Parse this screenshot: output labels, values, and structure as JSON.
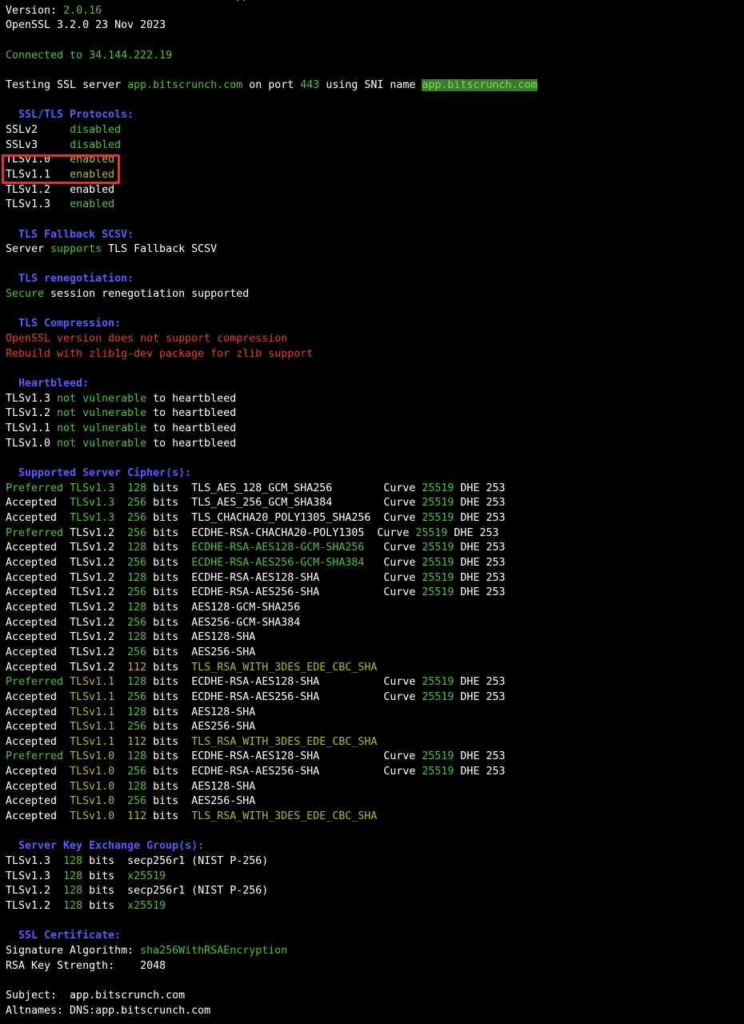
{
  "terminal": {
    "lines": [
      [
        {
          "t": "/Users/thatsshahid@... ~ % sslscan app.bitscrunch.com",
          "c": "white"
        }
      ],
      [
        {
          "t": "Version: ",
          "c": "white"
        },
        {
          "t": "2.0.16",
          "c": "green"
        }
      ],
      [
        {
          "t": "OpenSSL 3.2.0 23 Nov 2023",
          "c": "white"
        }
      ],
      [],
      [
        {
          "t": "Connected to 34.144.222.19",
          "c": "green"
        }
      ],
      [],
      [
        {
          "t": "Testing SSL server ",
          "c": "white"
        },
        {
          "t": "app.bitscrunch.com",
          "c": "green"
        },
        {
          "t": " on port ",
          "c": "white"
        },
        {
          "t": "443",
          "c": "green"
        },
        {
          "t": " using SNI name ",
          "c": "white"
        },
        {
          "t": "app.bitscrunch.com",
          "c": "hl"
        }
      ],
      [],
      [
        {
          "t": "  SSL/TLS Protocols:",
          "c": "blue"
        }
      ],
      [
        {
          "t": "SSLv2     ",
          "c": "white"
        },
        {
          "t": "disabled",
          "c": "green"
        }
      ],
      [
        {
          "t": "SSLv3     ",
          "c": "white"
        },
        {
          "t": "disabled",
          "c": "green"
        }
      ],
      [
        {
          "t": "TLSv1.0   ",
          "c": "white"
        },
        {
          "t": "enabled",
          "c": "yellow"
        }
      ],
      [
        {
          "t": "TLSv1.1   ",
          "c": "white"
        },
        {
          "t": "enabled",
          "c": "yellow"
        }
      ],
      [
        {
          "t": "TLSv1.2   ",
          "c": "white"
        },
        {
          "t": "enabled",
          "c": "white"
        }
      ],
      [
        {
          "t": "TLSv1.3   ",
          "c": "white"
        },
        {
          "t": "enabled",
          "c": "green"
        }
      ],
      [],
      [
        {
          "t": "  TLS Fallback SCSV:",
          "c": "blue"
        }
      ],
      [
        {
          "t": "Server ",
          "c": "white"
        },
        {
          "t": "supports",
          "c": "green"
        },
        {
          "t": " TLS Fallback SCSV",
          "c": "white"
        }
      ],
      [],
      [
        {
          "t": "  TLS renegotiation:",
          "c": "blue"
        }
      ],
      [
        {
          "t": "Secure",
          "c": "green"
        },
        {
          "t": " session renegotiation supported",
          "c": "white"
        }
      ],
      [],
      [
        {
          "t": "  TLS Compression:",
          "c": "blue"
        }
      ],
      [
        {
          "t": "OpenSSL version does not support compression",
          "c": "red"
        }
      ],
      [
        {
          "t": "Rebuild with zlib1g-dev package for zlib support",
          "c": "red"
        }
      ],
      [],
      [
        {
          "t": "  Heartbleed:",
          "c": "blue"
        }
      ],
      [
        {
          "t": "TLSv1.3 ",
          "c": "white"
        },
        {
          "t": "not vulnerable",
          "c": "green"
        },
        {
          "t": " to heartbleed",
          "c": "white"
        }
      ],
      [
        {
          "t": "TLSv1.2 ",
          "c": "white"
        },
        {
          "t": "not vulnerable",
          "c": "green"
        },
        {
          "t": " to heartbleed",
          "c": "white"
        }
      ],
      [
        {
          "t": "TLSv1.1 ",
          "c": "white"
        },
        {
          "t": "not vulnerable",
          "c": "green"
        },
        {
          "t": " to heartbleed",
          "c": "white"
        }
      ],
      [
        {
          "t": "TLSv1.0 ",
          "c": "white"
        },
        {
          "t": "not vulnerable",
          "c": "green"
        },
        {
          "t": " to heartbleed",
          "c": "white"
        }
      ],
      [],
      [
        {
          "t": "  Supported Server Cipher(s):",
          "c": "blue"
        }
      ],
      [
        {
          "t": "Preferred ",
          "c": "green"
        },
        {
          "t": "TLSv1.3",
          "c": "green"
        },
        {
          "t": "  ",
          "c": "white"
        },
        {
          "t": "128",
          "c": "green"
        },
        {
          "t": " bits  TLS_AES_128_GCM_SHA256        Curve ",
          "c": "white"
        },
        {
          "t": "25519",
          "c": "green"
        },
        {
          "t": " DHE 253",
          "c": "white"
        }
      ],
      [
        {
          "t": "Accepted  ",
          "c": "white"
        },
        {
          "t": "TLSv1.3",
          "c": "green"
        },
        {
          "t": "  ",
          "c": "white"
        },
        {
          "t": "256",
          "c": "green"
        },
        {
          "t": " bits  TLS_AES_256_GCM_SHA384        Curve ",
          "c": "white"
        },
        {
          "t": "25519",
          "c": "green"
        },
        {
          "t": " DHE 253",
          "c": "white"
        }
      ],
      [
        {
          "t": "Accepted  ",
          "c": "white"
        },
        {
          "t": "TLSv1.3",
          "c": "green"
        },
        {
          "t": "  ",
          "c": "white"
        },
        {
          "t": "256",
          "c": "green"
        },
        {
          "t": " bits  TLS_CHACHA20_POLY1305_SHA256  Curve ",
          "c": "white"
        },
        {
          "t": "25519",
          "c": "green"
        },
        {
          "t": " DHE 253",
          "c": "white"
        }
      ],
      [
        {
          "t": "Preferred ",
          "c": "green"
        },
        {
          "t": "TLSv1.2",
          "c": "white"
        },
        {
          "t": "  ",
          "c": "white"
        },
        {
          "t": "256",
          "c": "green"
        },
        {
          "t": " bits  ECDHE-RSA-CHACHA20-POLY1305  Curve ",
          "c": "white"
        },
        {
          "t": "25519",
          "c": "green"
        },
        {
          "t": " DHE 253",
          "c": "white"
        }
      ],
      [
        {
          "t": "Accepted  ",
          "c": "white"
        },
        {
          "t": "TLSv1.2",
          "c": "white"
        },
        {
          "t": "  ",
          "c": "white"
        },
        {
          "t": "128",
          "c": "green"
        },
        {
          "t": " bits  ",
          "c": "white"
        },
        {
          "t": "ECDHE-RSA-AES128-GCM-SHA256",
          "c": "green"
        },
        {
          "t": "   Curve ",
          "c": "white"
        },
        {
          "t": "25519",
          "c": "green"
        },
        {
          "t": " DHE 253",
          "c": "white"
        }
      ],
      [
        {
          "t": "Accepted  ",
          "c": "white"
        },
        {
          "t": "TLSv1.2",
          "c": "white"
        },
        {
          "t": "  ",
          "c": "white"
        },
        {
          "t": "256",
          "c": "green"
        },
        {
          "t": " bits  ",
          "c": "white"
        },
        {
          "t": "ECDHE-RSA-AES256-GCM-SHA384",
          "c": "green"
        },
        {
          "t": "   Curve ",
          "c": "white"
        },
        {
          "t": "25519",
          "c": "green"
        },
        {
          "t": " DHE 253",
          "c": "white"
        }
      ],
      [
        {
          "t": "Accepted  ",
          "c": "white"
        },
        {
          "t": "TLSv1.2",
          "c": "white"
        },
        {
          "t": "  ",
          "c": "white"
        },
        {
          "t": "128",
          "c": "green"
        },
        {
          "t": " bits  ECDHE-RSA-AES128-SHA          Curve ",
          "c": "white"
        },
        {
          "t": "25519",
          "c": "green"
        },
        {
          "t": " DHE 253",
          "c": "white"
        }
      ],
      [
        {
          "t": "Accepted  ",
          "c": "white"
        },
        {
          "t": "TLSv1.2",
          "c": "white"
        },
        {
          "t": "  ",
          "c": "white"
        },
        {
          "t": "256",
          "c": "green"
        },
        {
          "t": " bits  ECDHE-RSA-AES256-SHA          Curve ",
          "c": "white"
        },
        {
          "t": "25519",
          "c": "green"
        },
        {
          "t": " DHE 253",
          "c": "white"
        }
      ],
      [
        {
          "t": "Accepted  ",
          "c": "white"
        },
        {
          "t": "TLSv1.2",
          "c": "white"
        },
        {
          "t": "  ",
          "c": "white"
        },
        {
          "t": "128",
          "c": "green"
        },
        {
          "t": " bits  AES128-GCM-SHA256",
          "c": "white"
        }
      ],
      [
        {
          "t": "Accepted  ",
          "c": "white"
        },
        {
          "t": "TLSv1.2",
          "c": "white"
        },
        {
          "t": "  ",
          "c": "white"
        },
        {
          "t": "256",
          "c": "green"
        },
        {
          "t": " bits  AES256-GCM-SHA384",
          "c": "white"
        }
      ],
      [
        {
          "t": "Accepted  ",
          "c": "white"
        },
        {
          "t": "TLSv1.2",
          "c": "white"
        },
        {
          "t": "  ",
          "c": "white"
        },
        {
          "t": "128",
          "c": "green"
        },
        {
          "t": " bits  AES128-SHA",
          "c": "white"
        }
      ],
      [
        {
          "t": "Accepted  ",
          "c": "white"
        },
        {
          "t": "TLSv1.2",
          "c": "white"
        },
        {
          "t": "  ",
          "c": "white"
        },
        {
          "t": "256",
          "c": "green"
        },
        {
          "t": " bits  AES256-SHA",
          "c": "white"
        }
      ],
      [
        {
          "t": "Accepted  ",
          "c": "white"
        },
        {
          "t": "TLSv1.2",
          "c": "white"
        },
        {
          "t": "  ",
          "c": "white"
        },
        {
          "t": "112",
          "c": "yellow"
        },
        {
          "t": " bits  ",
          "c": "white"
        },
        {
          "t": "TLS_RSA_WITH_3DES_EDE_CBC_SHA",
          "c": "yellow"
        }
      ],
      [
        {
          "t": "Preferred ",
          "c": "green"
        },
        {
          "t": "TLSv1.1",
          "c": "yellow"
        },
        {
          "t": "  ",
          "c": "white"
        },
        {
          "t": "128",
          "c": "green"
        },
        {
          "t": " bits  ECDHE-RSA-AES128-SHA          Curve ",
          "c": "white"
        },
        {
          "t": "25519",
          "c": "green"
        },
        {
          "t": " DHE 253",
          "c": "white"
        }
      ],
      [
        {
          "t": "Accepted  ",
          "c": "white"
        },
        {
          "t": "TLSv1.1",
          "c": "yellow"
        },
        {
          "t": "  ",
          "c": "white"
        },
        {
          "t": "256",
          "c": "green"
        },
        {
          "t": " bits  ECDHE-RSA-AES256-SHA          Curve ",
          "c": "white"
        },
        {
          "t": "25519",
          "c": "green"
        },
        {
          "t": " DHE 253",
          "c": "white"
        }
      ],
      [
        {
          "t": "Accepted  ",
          "c": "white"
        },
        {
          "t": "TLSv1.1",
          "c": "yellow"
        },
        {
          "t": "  ",
          "c": "white"
        },
        {
          "t": "128",
          "c": "green"
        },
        {
          "t": " bits  AES128-SHA",
          "c": "white"
        }
      ],
      [
        {
          "t": "Accepted  ",
          "c": "white"
        },
        {
          "t": "TLSv1.1",
          "c": "yellow"
        },
        {
          "t": "  ",
          "c": "white"
        },
        {
          "t": "256",
          "c": "green"
        },
        {
          "t": " bits  AES256-SHA",
          "c": "white"
        }
      ],
      [
        {
          "t": "Accepted  ",
          "c": "white"
        },
        {
          "t": "TLSv1.1",
          "c": "yellow"
        },
        {
          "t": "  ",
          "c": "white"
        },
        {
          "t": "112",
          "c": "yellow"
        },
        {
          "t": " bits  ",
          "c": "white"
        },
        {
          "t": "TLS_RSA_WITH_3DES_EDE_CBC_SHA",
          "c": "yellow"
        }
      ],
      [
        {
          "t": "Preferred ",
          "c": "green"
        },
        {
          "t": "TLSv1.0",
          "c": "yellow"
        },
        {
          "t": "  ",
          "c": "white"
        },
        {
          "t": "128",
          "c": "green"
        },
        {
          "t": " bits  ECDHE-RSA-AES128-SHA          Curve ",
          "c": "white"
        },
        {
          "t": "25519",
          "c": "green"
        },
        {
          "t": " DHE 253",
          "c": "white"
        }
      ],
      [
        {
          "t": "Accepted  ",
          "c": "white"
        },
        {
          "t": "TLSv1.0",
          "c": "yellow"
        },
        {
          "t": "  ",
          "c": "white"
        },
        {
          "t": "256",
          "c": "green"
        },
        {
          "t": " bits  ECDHE-RSA-AES256-SHA          Curve ",
          "c": "white"
        },
        {
          "t": "25519",
          "c": "green"
        },
        {
          "t": " DHE 253",
          "c": "white"
        }
      ],
      [
        {
          "t": "Accepted  ",
          "c": "white"
        },
        {
          "t": "TLSv1.0",
          "c": "yellow"
        },
        {
          "t": "  ",
          "c": "white"
        },
        {
          "t": "128",
          "c": "green"
        },
        {
          "t": " bits  AES128-SHA",
          "c": "white"
        }
      ],
      [
        {
          "t": "Accepted  ",
          "c": "white"
        },
        {
          "t": "TLSv1.0",
          "c": "yellow"
        },
        {
          "t": "  ",
          "c": "white"
        },
        {
          "t": "256",
          "c": "green"
        },
        {
          "t": " bits  AES256-SHA",
          "c": "white"
        }
      ],
      [
        {
          "t": "Accepted  ",
          "c": "white"
        },
        {
          "t": "TLSv1.0",
          "c": "yellow"
        },
        {
          "t": "  ",
          "c": "white"
        },
        {
          "t": "112",
          "c": "yellow"
        },
        {
          "t": " bits  ",
          "c": "white"
        },
        {
          "t": "TLS_RSA_WITH_3DES_EDE_CBC_SHA",
          "c": "yellow"
        }
      ],
      [],
      [
        {
          "t": "  Server Key Exchange Group(s):",
          "c": "blue"
        }
      ],
      [
        {
          "t": "TLSv1.3  ",
          "c": "white"
        },
        {
          "t": "128",
          "c": "green"
        },
        {
          "t": " bits  secp256r1 (NIST P-256)",
          "c": "white"
        }
      ],
      [
        {
          "t": "TLSv1.3  ",
          "c": "white"
        },
        {
          "t": "128",
          "c": "green"
        },
        {
          "t": " bits  ",
          "c": "white"
        },
        {
          "t": "x25519",
          "c": "green"
        }
      ],
      [
        {
          "t": "TLSv1.2  ",
          "c": "white"
        },
        {
          "t": "128",
          "c": "green"
        },
        {
          "t": " bits  secp256r1 (NIST P-256)",
          "c": "white"
        }
      ],
      [
        {
          "t": "TLSv1.2  ",
          "c": "white"
        },
        {
          "t": "128",
          "c": "green"
        },
        {
          "t": " bits  ",
          "c": "white"
        },
        {
          "t": "x25519",
          "c": "green"
        }
      ],
      [],
      [
        {
          "t": "  SSL Certificate:",
          "c": "blue"
        }
      ],
      [
        {
          "t": "Signature Algorithm: ",
          "c": "white"
        },
        {
          "t": "sha256WithRSAEncryption",
          "c": "green"
        }
      ],
      [
        {
          "t": "RSA Key Strength:    2048",
          "c": "white"
        }
      ],
      [],
      [
        {
          "t": "Subject:  app.bitscrunch.com",
          "c": "white"
        }
      ],
      [
        {
          "t": "Altnames: DNS:app.bitscrunch.com",
          "c": "white"
        }
      ]
    ]
  },
  "colors": {
    "background": "#000000",
    "white": "#ffffff",
    "green": "#4ec23b",
    "yellow": "#b8b237",
    "red": "#e0402f",
    "blue": "#5a5aff",
    "highlight_box": "#e8321f"
  }
}
